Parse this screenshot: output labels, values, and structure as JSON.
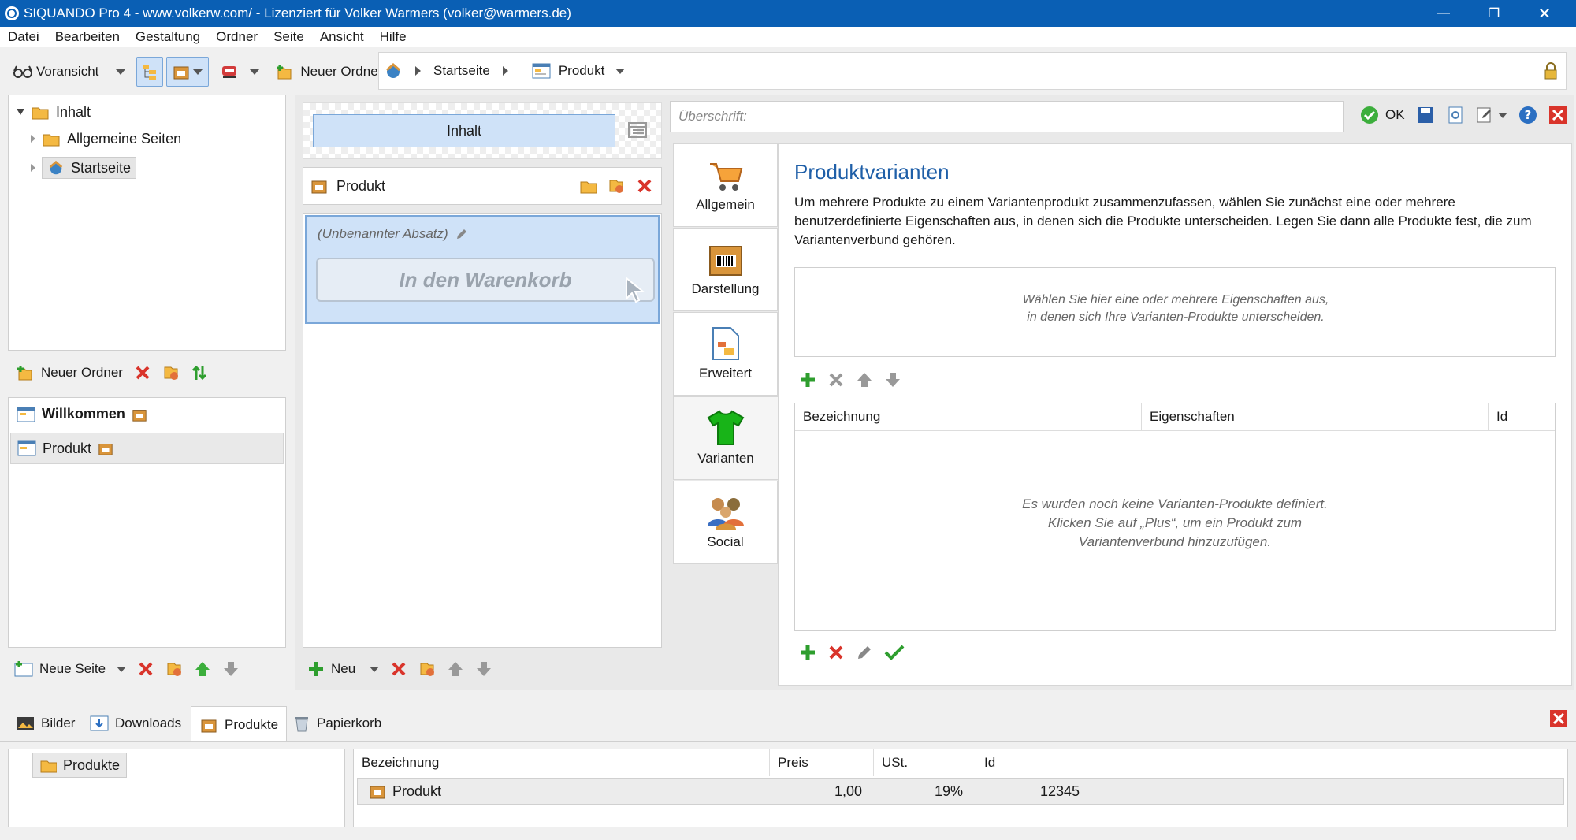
{
  "window": {
    "title": "SIQUANDO Pro 4 - www.volkerw.com/ - Lizenziert für Volker Warmers (volker@warmers.de)"
  },
  "menu": [
    "Datei",
    "Bearbeiten",
    "Gestaltung",
    "Ordner",
    "Seite",
    "Ansicht",
    "Hilfe"
  ],
  "toolbar": {
    "preview_label": "Voransicht",
    "new_folder_label": "Neuer Ordner"
  },
  "breadcrumb": {
    "items": [
      "Startseite",
      "Produkt"
    ]
  },
  "tree": {
    "root": "Inhalt",
    "items": [
      "Allgemeine Seiten",
      "Startseite"
    ]
  },
  "folder_actions": {
    "new_folder_label": "Neuer Ordner"
  },
  "pages": {
    "items": [
      "Willkommen",
      "Produkt"
    ]
  },
  "page_actions": {
    "new_page_label": "Neue Seite"
  },
  "editor": {
    "tab_label": "Inhalt",
    "product_label": "Produkt",
    "paragraph_label": "(Unbenannter Absatz)",
    "cart_button": "In den Warenkorb",
    "new_label": "Neu"
  },
  "heading": {
    "placeholder": "Überschrift:",
    "ok_label": "OK"
  },
  "side_tabs": [
    "Allgemein",
    "Darstellung",
    "Erweitert",
    "Varianten",
    "Social"
  ],
  "variants": {
    "title": "Produktvarianten",
    "description": "Um mehrere Produkte zu einem Variantenprodukt zusammenzufassen, wählen Sie zunächst eine oder mehrere benutzerdefinierte Eigenschaften aus, in denen sich die Produkte unterscheiden. Legen Sie dann alle Produkte fest, die zum Variantenverbund gehören.",
    "properties_hint_1": "Wählen Sie hier eine oder mehrere Eigenschaften aus,",
    "properties_hint_2": "in denen sich Ihre Varianten-Produkte unterscheiden.",
    "columns": [
      "Bezeichnung",
      "Eigenschaften",
      "Id"
    ],
    "empty_1": "Es wurden noch keine Varianten-Produkte definiert.",
    "empty_2": "Klicken Sie auf „Plus“, um ein Produkt zum",
    "empty_3": "Variantenverbund hinzuzufügen."
  },
  "bottom_tabs": [
    "Bilder",
    "Downloads",
    "Produkte",
    "Papierkorb"
  ],
  "products": {
    "folder_label": "Produkte",
    "columns": [
      "Bezeichnung",
      "Preis",
      "USt.",
      "Id"
    ],
    "rows": [
      {
        "name": "Produkt",
        "price": "1,00",
        "vat": "19%",
        "id": "12345"
      }
    ]
  },
  "colors": {
    "titlebar": "#0a5fb4",
    "selection": "#cfe2f8",
    "accent_green": "#2e9e2e",
    "delete_red": "#d9342b"
  }
}
